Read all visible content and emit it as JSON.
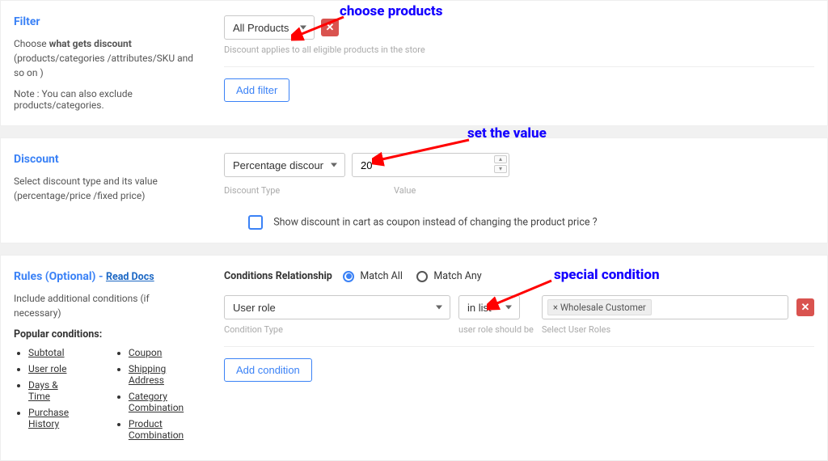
{
  "annotations": {
    "a1": "choose products",
    "a2": "set the value",
    "a3": "special condition"
  },
  "filter": {
    "title": "Filter",
    "desc_pre": "Choose ",
    "desc_bold": "what gets discount",
    "desc_post": " (products/categories /attributes/SKU and so on )",
    "note": "Note : You can also exclude products/categories.",
    "select": "All Products",
    "help": "Discount applies to all eligible products in the store",
    "add_filter": "Add filter"
  },
  "discount": {
    "title": "Discount",
    "desc": "Select discount type and its value (percentage/price /fixed price)",
    "type_select": "Percentage discount",
    "value": "20",
    "type_label": "Discount Type",
    "value_label": "Value",
    "checkbox_label": "Show discount in cart as coupon instead of changing the product price ?"
  },
  "rules": {
    "title": "Rules (Optional) - ",
    "read_docs": "Read Docs",
    "desc": "Include additional conditions (if necessary)",
    "popular_title": "Popular conditions:",
    "col1": [
      "Subtotal",
      "User role",
      "Days & Time",
      "Purchase History"
    ],
    "col2": [
      "Coupon",
      "Shipping Address",
      "Category Combination",
      "Product Combination"
    ],
    "cond_rel_label": "Conditions Relationship",
    "match_all": "Match All",
    "match_any": "Match Any",
    "cond_type": "User role",
    "cond_op": "in list",
    "cond_type_label": "Condition Type",
    "cond_op_label": "user role should be",
    "tag": "× Wholesale Customer",
    "roles_label": "Select User Roles",
    "add_condition": "Add condition"
  }
}
